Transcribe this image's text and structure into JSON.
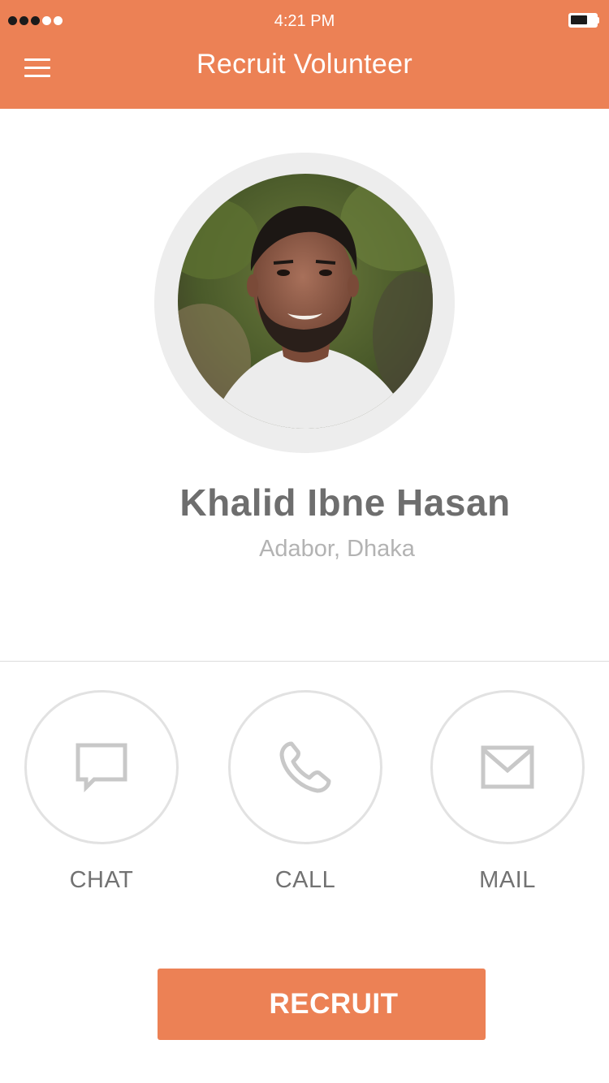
{
  "status_bar": {
    "time": "4:21 PM",
    "signal_bars_filled": 3,
    "signal_bars_total": 5,
    "battery_level": 0.7
  },
  "header": {
    "title": "Recruit Volunteer",
    "menu_icon": "hamburger-menu-icon",
    "background_color": "#EC8155"
  },
  "profile": {
    "name": "Khalid Ibne Hasan",
    "location": "Adabor, Dhaka"
  },
  "actions": [
    {
      "label": "CHAT",
      "icon": "chat-bubble-icon"
    },
    {
      "label": "CALL",
      "icon": "phone-icon"
    },
    {
      "label": "MAIL",
      "icon": "envelope-icon"
    }
  ],
  "recruit_button": {
    "label": "RECRUIT",
    "color": "#EC8155"
  }
}
